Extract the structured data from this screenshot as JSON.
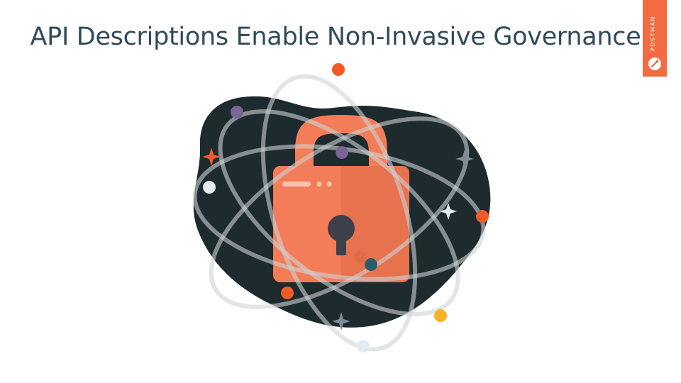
{
  "slide": {
    "title": "API Descriptions Enable Non-Invasive Governance"
  },
  "brand": {
    "name": "POSTMAN",
    "logo_icon": "postman-logo-icon",
    "color": "#f36b3f"
  },
  "illustration": {
    "subject": "padlock-with-orbits",
    "icons": [
      "padlock-icon",
      "keyhole-icon",
      "star-icon",
      "orbit-ring",
      "orbit-planet"
    ],
    "colors": {
      "blob": "#1d2a2e",
      "lock_body": "#f27d58",
      "lock_shade": "#dc6a47",
      "orbit": "#cfd2d3",
      "accent_orange": "#f05a28",
      "accent_purple": "#7a6596",
      "accent_light": "#e4ecf2",
      "accent_teal": "#2c5d6b",
      "accent_yellow": "#f8b124"
    }
  }
}
